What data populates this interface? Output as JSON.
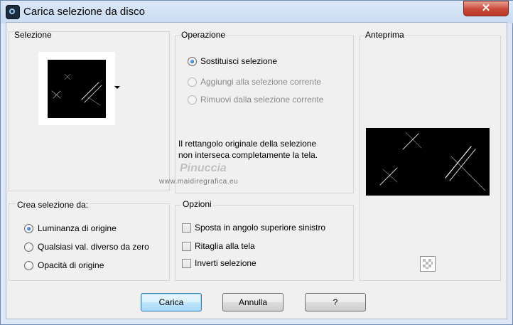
{
  "window": {
    "title": "Carica selezione da disco",
    "close_glyph": "✕"
  },
  "selezione": {
    "label": "Selezione"
  },
  "operazione": {
    "label": "Operazione",
    "options": [
      {
        "label": "Sostituisci selezione",
        "checked": true,
        "enabled": true
      },
      {
        "label": "Aggiungi alla selezione corrente",
        "checked": false,
        "enabled": false
      },
      {
        "label": "Rimuovi dalla selezione corrente",
        "checked": false,
        "enabled": false
      }
    ],
    "note": "Il rettangolo originale della selezione non interseca completamente la tela."
  },
  "watermark": {
    "name": "Pinuccia",
    "site": "www.maidiregrafica.eu"
  },
  "anteprima": {
    "label": "Anteprima"
  },
  "crea": {
    "label": "Crea selezione da:",
    "options": [
      {
        "label": "Luminanza di origine",
        "checked": true
      },
      {
        "label": "Qualsiasi val. diverso da zero",
        "checked": false
      },
      {
        "label": "Opacità di origine",
        "checked": false
      }
    ]
  },
  "opzioni": {
    "label": "Opzioni",
    "checks": [
      {
        "label": "Sposta in angolo superiore sinistro",
        "checked": false
      },
      {
        "label": "Ritaglia alla tela",
        "checked": false
      },
      {
        "label": "Inverti selezione",
        "checked": false
      }
    ]
  },
  "buttons": {
    "load": "Carica",
    "cancel": "Annulla",
    "help": "?"
  }
}
